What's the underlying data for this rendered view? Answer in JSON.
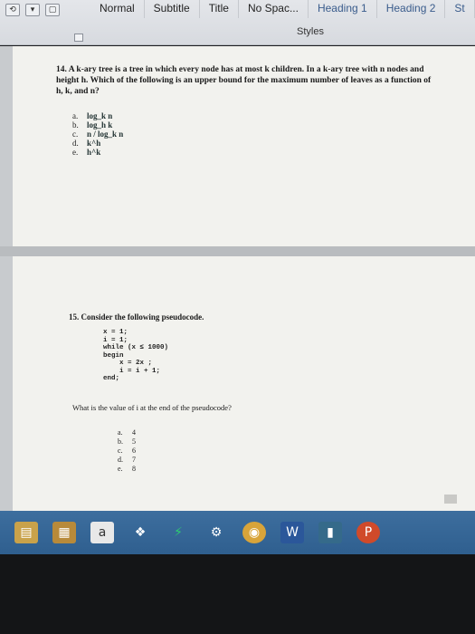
{
  "ribbon": {
    "styles": [
      "Normal",
      "Subtitle",
      "Title",
      "No Spac...",
      "Heading 1",
      "Heading 2",
      "St"
    ],
    "styles_label": "Styles"
  },
  "q14": {
    "text": "14. A k-ary tree is a tree in which every node has at most k children. In a k-ary tree with n nodes and height h. Which of the following is an upper bound for the maximum number of leaves as a function of h, k, and n?",
    "options": [
      {
        "letter": "a.",
        "value": "log_k n"
      },
      {
        "letter": "b.",
        "value": "log_h k"
      },
      {
        "letter": "c.",
        "value": "n / log_k n"
      },
      {
        "letter": "d.",
        "value": "k^h"
      },
      {
        "letter": "e.",
        "value": "h^k"
      }
    ]
  },
  "q15": {
    "text": "15. Consider the following pseudocode.",
    "code": "x = 1;\ni = 1;\nwhile (x ≤ 1000)\nbegin\n    x = 2x ;\n    i = i + 1;\nend;",
    "question": "What is the value of i at the end of the pseudocode?",
    "options": [
      {
        "letter": "a.",
        "value": "4"
      },
      {
        "letter": "b.",
        "value": "5"
      },
      {
        "letter": "c.",
        "value": "6"
      },
      {
        "letter": "d.",
        "value": "7"
      },
      {
        "letter": "e.",
        "value": "8"
      }
    ]
  },
  "taskbar": {
    "icons": [
      "explorer-icon",
      "store-icon",
      "word-icon",
      "dropbox-icon",
      "app-icon",
      "settings-icon",
      "chrome-icon",
      "word-taskbar-icon",
      "media-icon",
      "powerpoint-icon"
    ]
  }
}
